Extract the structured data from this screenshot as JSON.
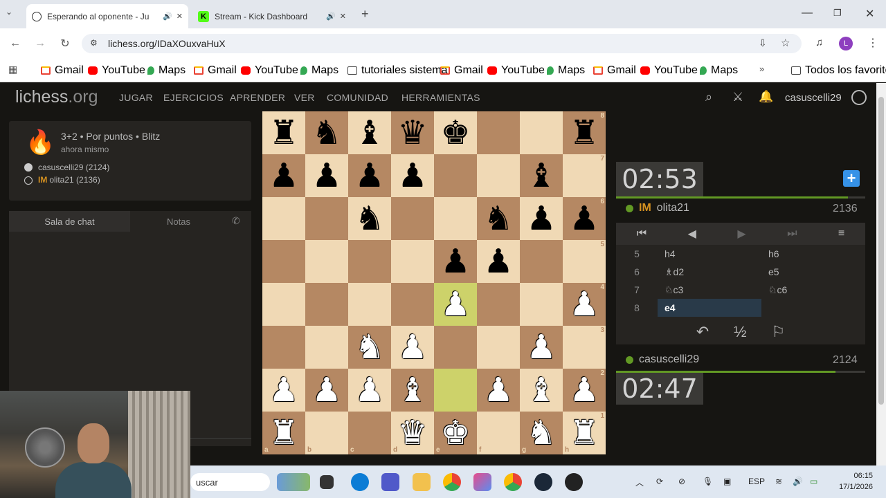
{
  "browser": {
    "tabs": [
      {
        "title": "Esperando al oponente - Ju",
        "active": true
      },
      {
        "title": "Stream - Kick Dashboard",
        "active": false
      }
    ],
    "url": "lichess.org/IDaXOuxvaHuX",
    "bookmarks": [
      "Gmail",
      "YouTube",
      "Maps",
      "Gmail",
      "YouTube",
      "Maps",
      "tutoriales sistema",
      "Gmail",
      "YouTube",
      "Maps",
      "Gmail",
      "YouTube",
      "Maps"
    ],
    "all_bookmarks": "Todos los favoritos",
    "profile_letter": "L"
  },
  "site": {
    "logo_main": "lichess",
    "logo_tld": ".org",
    "nav": [
      "JUGAR",
      "EJERCICIOS",
      "APRENDER",
      "VER",
      "COMUNIDAD",
      "HERRAMIENTAS"
    ],
    "username": "casuscelli29"
  },
  "game": {
    "mode": "3+2 • Por puntos • Blitz",
    "when": "ahora mismo",
    "white_player": "casuscelli29 (2124)",
    "black_title": "IM",
    "black_player": "olita21 (2136)"
  },
  "chat": {
    "tab_chat": "Sala de chat",
    "tab_notes": "Notas"
  },
  "board": {
    "ranks": [
      "8",
      "7",
      "6",
      "5",
      "4",
      "3",
      "2",
      "1"
    ],
    "files": [
      "a",
      "b",
      "c",
      "d",
      "e",
      "f",
      "g",
      "h"
    ],
    "position": [
      "rnbqk..r",
      "pppp..b.",
      "..n..npp",
      "....pp..",
      "....P..P",
      "..NP..P.",
      "PPPB.PBP",
      "R..QK.NR"
    ],
    "highlight": [
      "e4",
      "e2"
    ],
    "pieces": {
      "K": "♚",
      "Q": "♛",
      "R": "♜",
      "B": "♝",
      "N": "♞",
      "P": "♟",
      "k": "♚",
      "q": "♛",
      "r": "♜",
      "b": "♝",
      "n": "♞",
      "p": "♟"
    }
  },
  "opponent": {
    "title": "IM",
    "name": "olita21",
    "rating": "2136",
    "clock": "02:53",
    "time_fraction": 0.93
  },
  "me": {
    "name": "casuscelli29",
    "rating": "2124",
    "clock": "02:47",
    "time_fraction": 0.88
  },
  "moves": [
    {
      "n": "5",
      "w": "h4",
      "b": "h6"
    },
    {
      "n": "6",
      "w": "♗d2",
      "b": "e5"
    },
    {
      "n": "7",
      "w": "♘c3",
      "b": "♘c6"
    },
    {
      "n": "8",
      "w": "e4",
      "b": ""
    }
  ],
  "controls": {
    "first": "⏮",
    "prev": "◀",
    "next": "▶",
    "last": "⏭",
    "menu": "≡"
  },
  "actions": {
    "takeback": "↶",
    "draw": "½",
    "resign": "⚐"
  },
  "taskbar": {
    "search": "uscar",
    "lang": "ESP",
    "time": "06:15",
    "date": "17/1/2026"
  },
  "colors": {
    "accent": "#629924",
    "title": "#d59120",
    "highlight": "#cdd26a",
    "light": "#f0d9b5",
    "dark": "#b58863"
  }
}
